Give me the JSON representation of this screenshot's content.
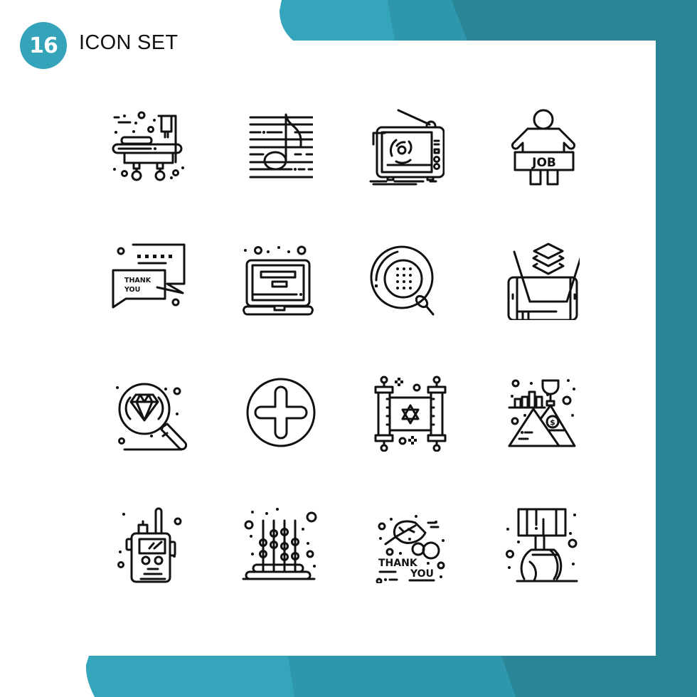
{
  "header": {
    "badge_number": "16",
    "title": "ICON SET"
  },
  "colors": {
    "teal_light": "#35a5bb",
    "teal_mid": "#2e97ab",
    "teal_dark": "#2a8697",
    "icon_stroke": "#111111",
    "panel": "#ffffff"
  },
  "icons": [
    {
      "name": "hospital-stretcher-icon",
      "row": 1,
      "col": 1
    },
    {
      "name": "music-note-icon",
      "row": 1,
      "col": 2
    },
    {
      "name": "retro-tv-icon",
      "row": 1,
      "col": 3
    },
    {
      "name": "job-seeker-icon",
      "row": 1,
      "col": 4,
      "text": "JOB"
    },
    {
      "name": "thank-you-chat-icon",
      "row": 2,
      "col": 1,
      "text_line1": "THANK",
      "text_line2": "YOU"
    },
    {
      "name": "laptop-icon",
      "row": 2,
      "col": 2
    },
    {
      "name": "egg-sperm-icon",
      "row": 2,
      "col": 3
    },
    {
      "name": "smartphone-hologram-layers-icon",
      "row": 2,
      "col": 4
    },
    {
      "name": "diamond-search-icon",
      "row": 3,
      "col": 1
    },
    {
      "name": "plus-circle-icon",
      "row": 3,
      "col": 2
    },
    {
      "name": "torah-scroll-icon",
      "row": 3,
      "col": 3
    },
    {
      "name": "mountain-trophy-success-icon",
      "row": 3,
      "col": 4,
      "text": "$"
    },
    {
      "name": "walkie-talkie-icon",
      "row": 4,
      "col": 1
    },
    {
      "name": "abacus-icon",
      "row": 4,
      "col": 2
    },
    {
      "name": "thank-you-leaf-icon",
      "row": 4,
      "col": 3,
      "text_line1": "THANK",
      "text_line2": "YOU"
    },
    {
      "name": "table-lamp-icon",
      "row": 4,
      "col": 4
    }
  ]
}
